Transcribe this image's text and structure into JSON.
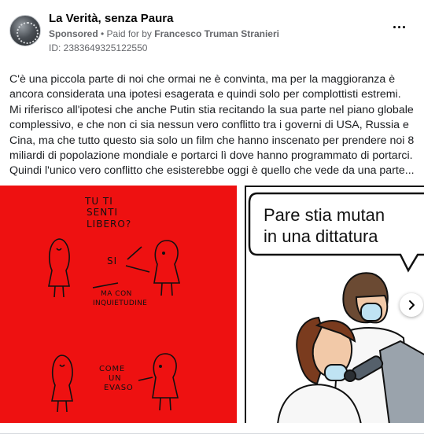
{
  "post": {
    "page_name": "La Verità, senza Paura",
    "sponsored_label": "Sponsored",
    "separator": " • ",
    "paid_for_label": "Paid for by ",
    "payer": "Francesco Truman Stranieri",
    "ad_id": "ID: 2383649325122550",
    "body_lines": [
      "C'è una piccola parte di noi che ormai ne è convinta, ma per la maggioranza è",
      "ancora considerata una ipotesi esagerata e quindi solo per complottisti estremi.",
      "Mi riferisco all'ipotesi che anche Putin stia recitando la sua parte nel piano globale",
      "complessivo, e che non ci sia nessun vero conflitto tra i governi di USA, Russia e",
      "Cina, ma che tutto questo sia solo un film che hanno inscenato per prendere noi 8",
      "miliardi di popolazione mondiale e portarci lì dove hanno programmato di portarci.",
      "Quindi l'unico vero conflitto che esisterebbe oggi è quello che vede da una parte..."
    ]
  },
  "comic_red": {
    "bubble1": [
      "TU TI",
      "SENTI",
      "LIBERO?"
    ],
    "bubble2": "SI",
    "bubble3": [
      "MA CON",
      "INQUIETUDINE"
    ],
    "bubble4": [
      "COME",
      "UN",
      "EVASO"
    ]
  },
  "comic_sci": {
    "caption_lines": [
      "Pare stia mutan",
      "in una dittatura"
    ]
  },
  "icons": {
    "more": "more-horizontal-icon",
    "next": "chevron-right-icon",
    "avatar": "page-avatar"
  },
  "colors": {
    "comic_red_bg": "#ee1111",
    "meta_gray": "#65676b"
  }
}
